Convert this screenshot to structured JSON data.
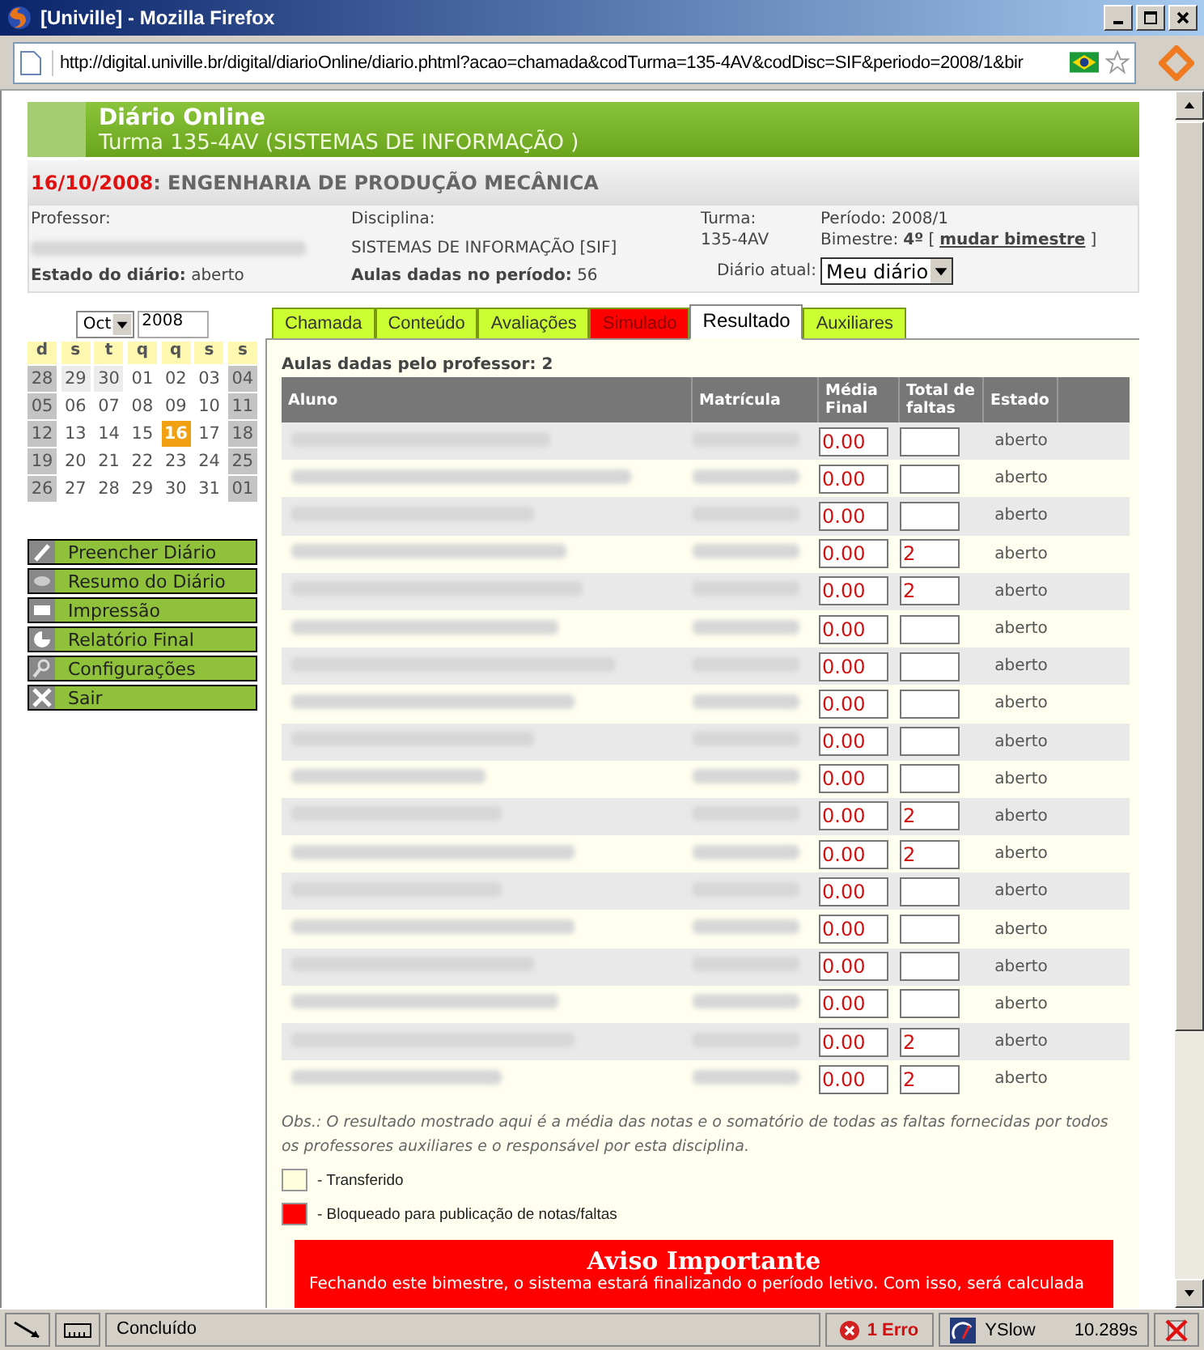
{
  "window": {
    "title": "[Univille] - Mozilla Firefox"
  },
  "address_bar": {
    "url": "http://digital.univille.br/digital/diarioOnline/diario.phtml?acao=chamada&codTurma=135-4AV&codDisc=SIF&periodo=2008/1&bir"
  },
  "header": {
    "title": "Diário Online",
    "subtitle": "Turma 135-4AV (SISTEMAS DE INFORMAÇÃO )"
  },
  "date_bar": {
    "date": "16/10/2008",
    "course": ": ENGENHARIA DE PRODUÇÃO MECÂNICA"
  },
  "info": {
    "professor_label": "Professor:",
    "disciplina_label": "Disciplina:",
    "disciplina": "SISTEMAS DE INFORMAÇÃO [SIF]",
    "turma_label": "Turma:",
    "turma": "135-4AV",
    "periodo": "Período: 2008/1",
    "bimestre_label": "Bimestre:",
    "bimestre": "4º",
    "bracket_open": "[",
    "bimestre_link": "mudar bimestre",
    "bracket_close": "]",
    "estado": "**Estado do diário:** aberto",
    "aulas": "**Aulas dadas no período:** 56",
    "diario_label": "Diário atual:",
    "diario_value": "Meu diário"
  },
  "calendar": {
    "month": "Oct",
    "year": "2008",
    "weekdays": [
      "d",
      "s",
      "t",
      "q",
      "q",
      "s",
      "s"
    ],
    "days": [
      {
        "day": "28",
        "kind": "weekend",
        "selected": false
      },
      {
        "day": "29",
        "kind": "other",
        "selected": false
      },
      {
        "day": "30",
        "kind": "other",
        "selected": false
      },
      {
        "day": "01",
        "kind": "day",
        "selected": false
      },
      {
        "day": "02",
        "kind": "day",
        "selected": false
      },
      {
        "day": "03",
        "kind": "day",
        "selected": false
      },
      {
        "day": "04",
        "kind": "weekend",
        "selected": false
      },
      {
        "day": "05",
        "kind": "weekend",
        "selected": false
      },
      {
        "day": "06",
        "kind": "day",
        "selected": false
      },
      {
        "day": "07",
        "kind": "day",
        "selected": false
      },
      {
        "day": "08",
        "kind": "day",
        "selected": false
      },
      {
        "day": "09",
        "kind": "day",
        "selected": false
      },
      {
        "day": "10",
        "kind": "day",
        "selected": false
      },
      {
        "day": "11",
        "kind": "weekend",
        "selected": false
      },
      {
        "day": "12",
        "kind": "weekend",
        "selected": false
      },
      {
        "day": "13",
        "kind": "day",
        "selected": false
      },
      {
        "day": "14",
        "kind": "day",
        "selected": false
      },
      {
        "day": "15",
        "kind": "day",
        "selected": false
      },
      {
        "day": "16",
        "kind": "day",
        "selected": true
      },
      {
        "day": "17",
        "kind": "day",
        "selected": false
      },
      {
        "day": "18",
        "kind": "weekend",
        "selected": false
      },
      {
        "day": "19",
        "kind": "weekend",
        "selected": false
      },
      {
        "day": "20",
        "kind": "day",
        "selected": false
      },
      {
        "day": "21",
        "kind": "day",
        "selected": false
      },
      {
        "day": "22",
        "kind": "day",
        "selected": false
      },
      {
        "day": "23",
        "kind": "day",
        "selected": false
      },
      {
        "day": "24",
        "kind": "day",
        "selected": false
      },
      {
        "day": "25",
        "kind": "weekend",
        "selected": false
      },
      {
        "day": "26",
        "kind": "weekend",
        "selected": false
      },
      {
        "day": "27",
        "kind": "day",
        "selected": false
      },
      {
        "day": "28",
        "kind": "day",
        "selected": false
      },
      {
        "day": "29",
        "kind": "day",
        "selected": false
      },
      {
        "day": "30",
        "kind": "day",
        "selected": false
      },
      {
        "day": "31",
        "kind": "day",
        "selected": false
      },
      {
        "day": "01",
        "kind": "weekend",
        "selected": false
      }
    ]
  },
  "menu": [
    {
      "label": "Preencher Diário",
      "kind": "pencil"
    },
    {
      "label": "Resumo do Diário",
      "kind": "eye"
    },
    {
      "label": "Impressão",
      "kind": "printer"
    },
    {
      "label": "Relatório Final",
      "kind": "chart"
    },
    {
      "label": "Configurações",
      "kind": "search"
    },
    {
      "label": "Sair",
      "kind": "close"
    }
  ],
  "tabs": [
    {
      "label": "Chamada",
      "selected": false,
      "blocked": false
    },
    {
      "label": "Conteúdo",
      "selected": false,
      "blocked": false
    },
    {
      "label": "Avaliações",
      "selected": false,
      "blocked": false
    },
    {
      "label": "Simulado",
      "selected": false,
      "blocked": true
    },
    {
      "label": "Resultado",
      "selected": true,
      "blocked": false
    },
    {
      "label": "Auxiliares",
      "selected": false,
      "blocked": false
    }
  ],
  "summary": "Aulas dadas pelo professor: 2",
  "table": {
    "columns": [
      "Aluno",
      "Matrícula",
      "Média Final",
      "Total de faltas",
      "Estado"
    ],
    "rows": [
      {
        "media": "0.00",
        "estado": "aberto"
      },
      {
        "media": "0.00",
        "estado": "aberto"
      },
      {
        "media": "0.00",
        "estado": "aberto"
      },
      {
        "media": "0.00",
        "faltas": "2",
        "estado": "aberto"
      },
      {
        "media": "0.00",
        "faltas": "2",
        "estado": "aberto"
      },
      {
        "media": "0.00",
        "estado": "aberto"
      },
      {
        "media": "0.00",
        "estado": "aberto"
      },
      {
        "media": "0.00",
        "estado": "aberto"
      },
      {
        "media": "0.00",
        "estado": "aberto"
      },
      {
        "media": "0.00",
        "estado": "aberto"
      },
      {
        "media": "0.00",
        "faltas": "2",
        "estado": "aberto"
      },
      {
        "media": "0.00",
        "faltas": "2",
        "estado": "aberto"
      },
      {
        "media": "0.00",
        "estado": "aberto"
      },
      {
        "media": "0.00",
        "estado": "aberto"
      },
      {
        "media": "0.00",
        "estado": "aberto"
      },
      {
        "media": "0.00",
        "estado": "aberto"
      },
      {
        "media": "0.00",
        "faltas": "2",
        "estado": "aberto"
      },
      {
        "media": "0.00",
        "faltas": "2",
        "estado": "aberto"
      }
    ]
  },
  "note": "Obs.: O resultado mostrado aqui é a média das notas e o somatório de todas as faltas fornecidas por todos os professores auxiliares e o responsável por esta disciplina.",
  "legend": [
    {
      "label": "- Transferido",
      "color": "#ffffdd"
    },
    {
      "label": "- Bloqueado para publicação de notas/faltas",
      "color": "#ff0000"
    }
  ],
  "warning": {
    "title": "Aviso Importante",
    "text": "Fechando este bimestre, o sistema estará finalizando o período letivo. Com isso, será calculada"
  },
  "status_bar": {
    "text": "Concluído",
    "errors": "1 Erro",
    "yslow": "YSlow",
    "time": "10.289s"
  }
}
